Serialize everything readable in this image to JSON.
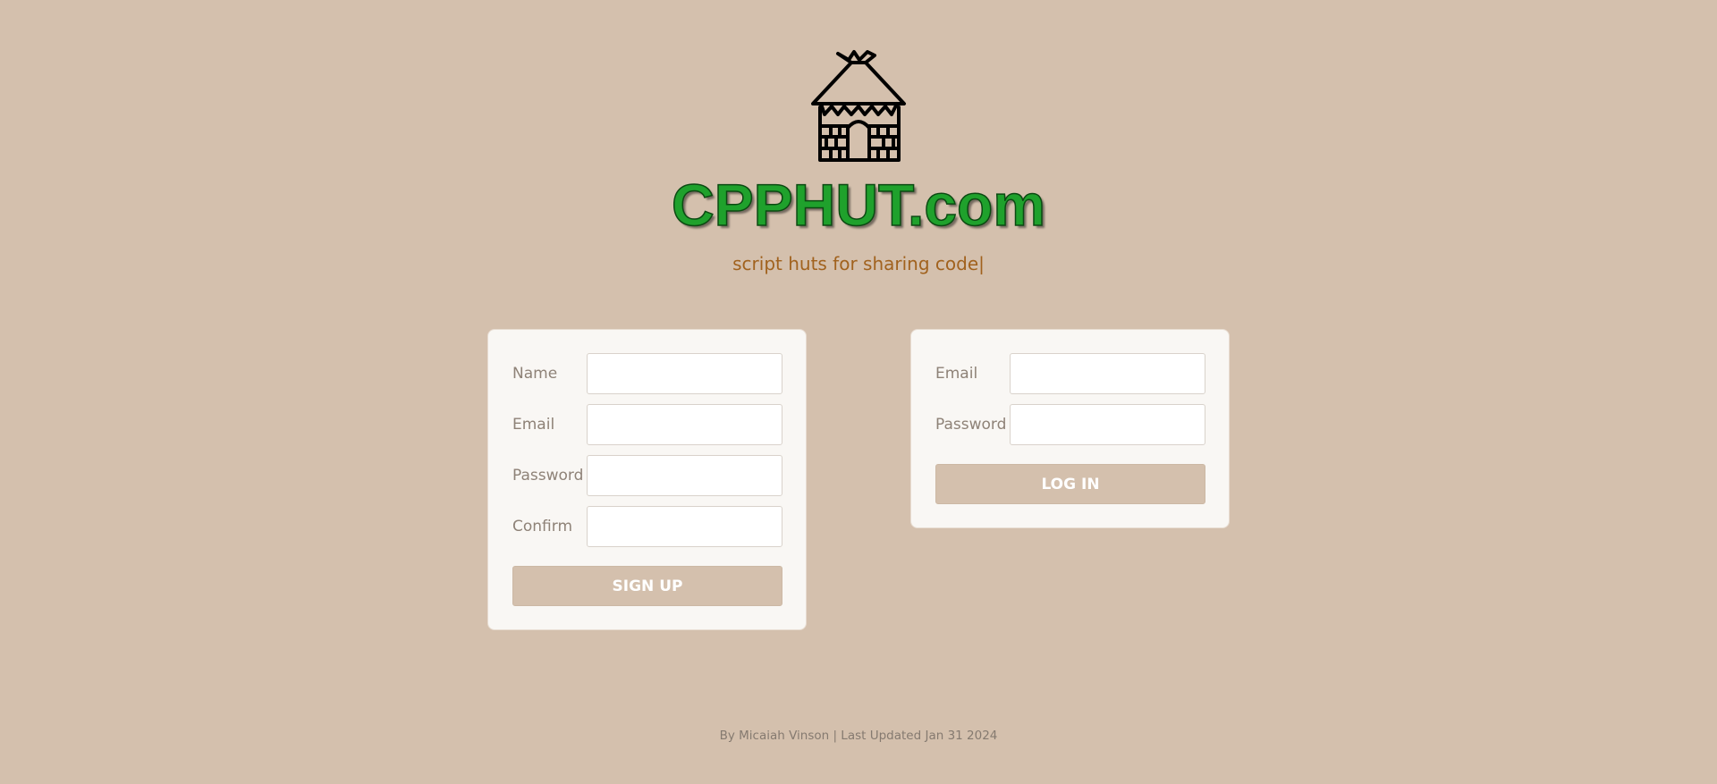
{
  "header": {
    "logo_icon": "hut-icon",
    "title": "CPPHUT.com",
    "tagline": "script huts for sharing code|",
    "title_color": "#1fa12c",
    "tagline_color": "#a1621e"
  },
  "signup": {
    "fields": [
      {
        "label": "Name",
        "value": "",
        "placeholder": ""
      },
      {
        "label": "Email",
        "value": "",
        "placeholder": ""
      },
      {
        "label": "Password",
        "value": "",
        "placeholder": ""
      },
      {
        "label": "Confirm",
        "value": "",
        "placeholder": ""
      }
    ],
    "button_label": "SIGN UP"
  },
  "login": {
    "fields": [
      {
        "label": "Email",
        "value": "",
        "placeholder": ""
      },
      {
        "label": "Password",
        "value": "",
        "placeholder": ""
      }
    ],
    "button_label": "LOG IN"
  },
  "footer": {
    "text": "By Micaiah Vinson | Last Updated Jan 31 2024"
  },
  "colors": {
    "background": "#d4c0ad",
    "card": "#f9f7f4",
    "button": "#d4c0ad"
  }
}
